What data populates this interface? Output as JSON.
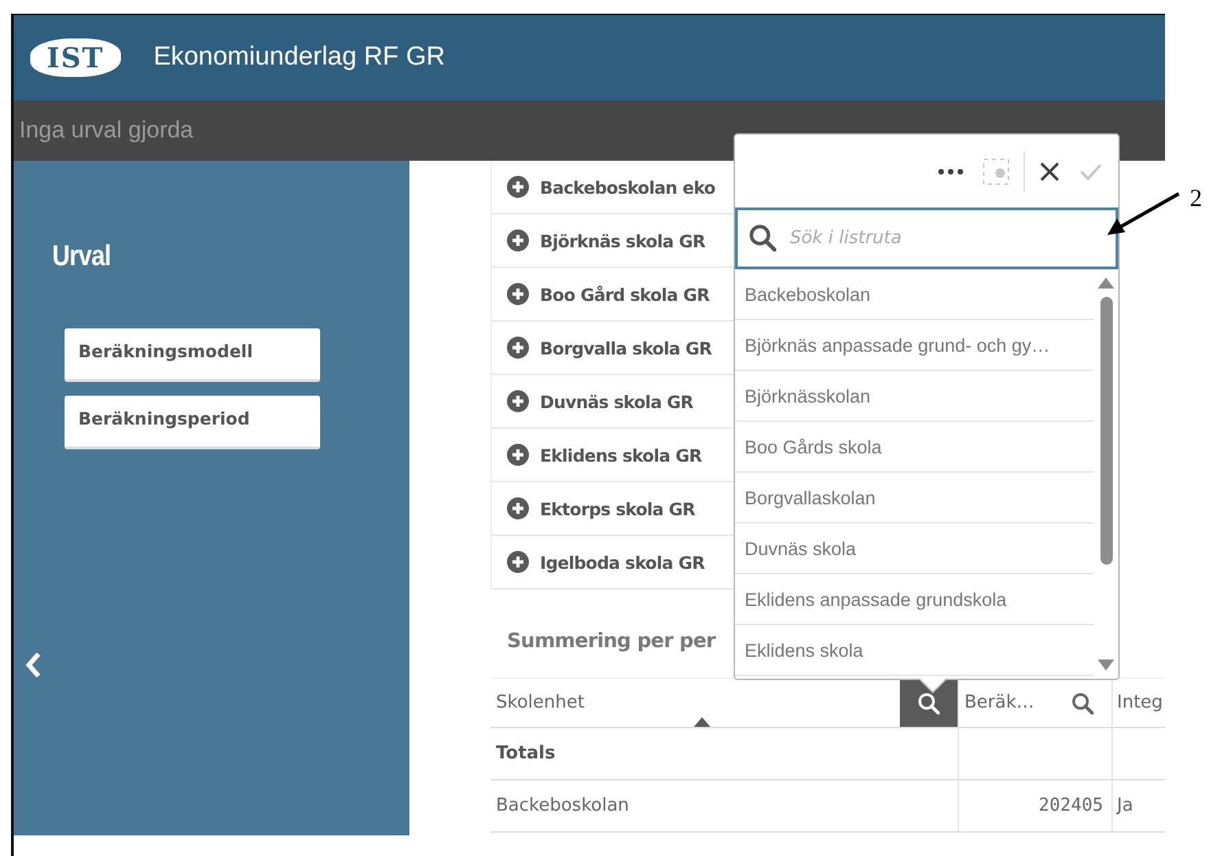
{
  "header": {
    "logo": "IST",
    "title": "Ekonomiunderlag RF GR"
  },
  "selection_bar": {
    "text": "Inga urval gjorda"
  },
  "sidebar": {
    "title": "Urval",
    "filters": [
      "Beräkningsmodell",
      "Beräkningsperiod"
    ]
  },
  "school_list": {
    "items": [
      "Backeboskolan eko",
      "Björknäs skola GR",
      "Boo Gård skola GR",
      "Borgvalla skola GR",
      "Duvnäs skola GR",
      "Eklidens skola GR",
      "Ektorps skola GR",
      "Igelboda skola GR"
    ]
  },
  "summary": {
    "title": "Summering per per",
    "columns": [
      {
        "label": "Skolenhet",
        "sorted": true,
        "search_active": true
      },
      {
        "label": "Beräk…",
        "search_active": false
      },
      {
        "label": "Integ"
      }
    ],
    "totals_label": "Totals",
    "rows": [
      [
        "Backeboskolan",
        "202405",
        "Ja"
      ]
    ]
  },
  "listbox": {
    "confirm_disabled": true,
    "placeholder": "Sök i listruta",
    "items": [
      "Backeboskolan",
      "Björknäs anpassade grund- och gy…",
      "Björknässkolan",
      "Boo Gårds skola",
      "Borgvallaskolan",
      "Duvnäs skola",
      "Eklidens anpassade grundskola",
      "Eklidens skola"
    ]
  },
  "annotation": {
    "label": "2"
  }
}
